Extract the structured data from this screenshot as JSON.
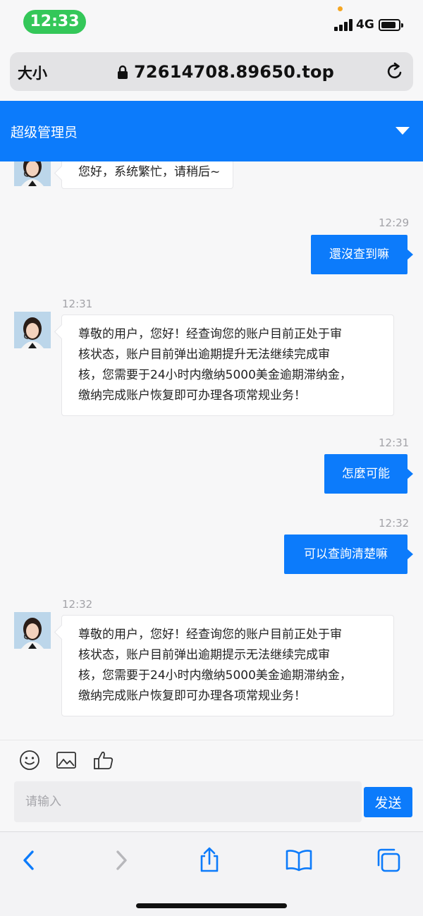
{
  "status_bar": {
    "time": "12:33",
    "network": "4G"
  },
  "browser": {
    "text_size_label": "大小",
    "url": "72614708.89650.top"
  },
  "header": {
    "title": "超级管理员"
  },
  "messages": [
    {
      "from": "agent",
      "text": "您好，系统繁忙，请稍后~"
    },
    {
      "from": "user",
      "time": "12:29",
      "text": "還沒查到嘛"
    },
    {
      "from": "agent",
      "time": "12:31",
      "lines": [
        "尊敬的用户，您好！经查询您的账户目前正处于审",
        "核状态，账户目前弹出逾期提升无法继续完成审",
        "核，您需要于24小时内缴纳5000美金逾期滞纳金，",
        "缴纳完成账户恢复即可办理各项常规业务！"
      ]
    },
    {
      "from": "user",
      "time": "12:31",
      "text": "怎麼可能"
    },
    {
      "from": "user",
      "time": "12:32",
      "text": "可以查詢清楚嘛"
    },
    {
      "from": "agent",
      "time": "12:32",
      "lines": [
        "尊敬的用户，您好！经查询您的账户目前正处于审",
        "核状态，账户目前弹出逾期提示无法继续完成审",
        "核，您需要于24小时内缴纳5000美金逾期滞纳金，",
        "缴纳完成账户恢复即可办理各项常规业务！"
      ]
    }
  ],
  "composer": {
    "placeholder": "请输入",
    "send_label": "发送"
  },
  "toolbar": {
    "icons": [
      "back-icon",
      "forward-icon",
      "share-icon",
      "bookmarks-icon",
      "tabs-icon"
    ]
  },
  "colors": {
    "accent": "#0c7bfb",
    "time_pill": "#34c759",
    "notify_dot": "#f5a623"
  }
}
